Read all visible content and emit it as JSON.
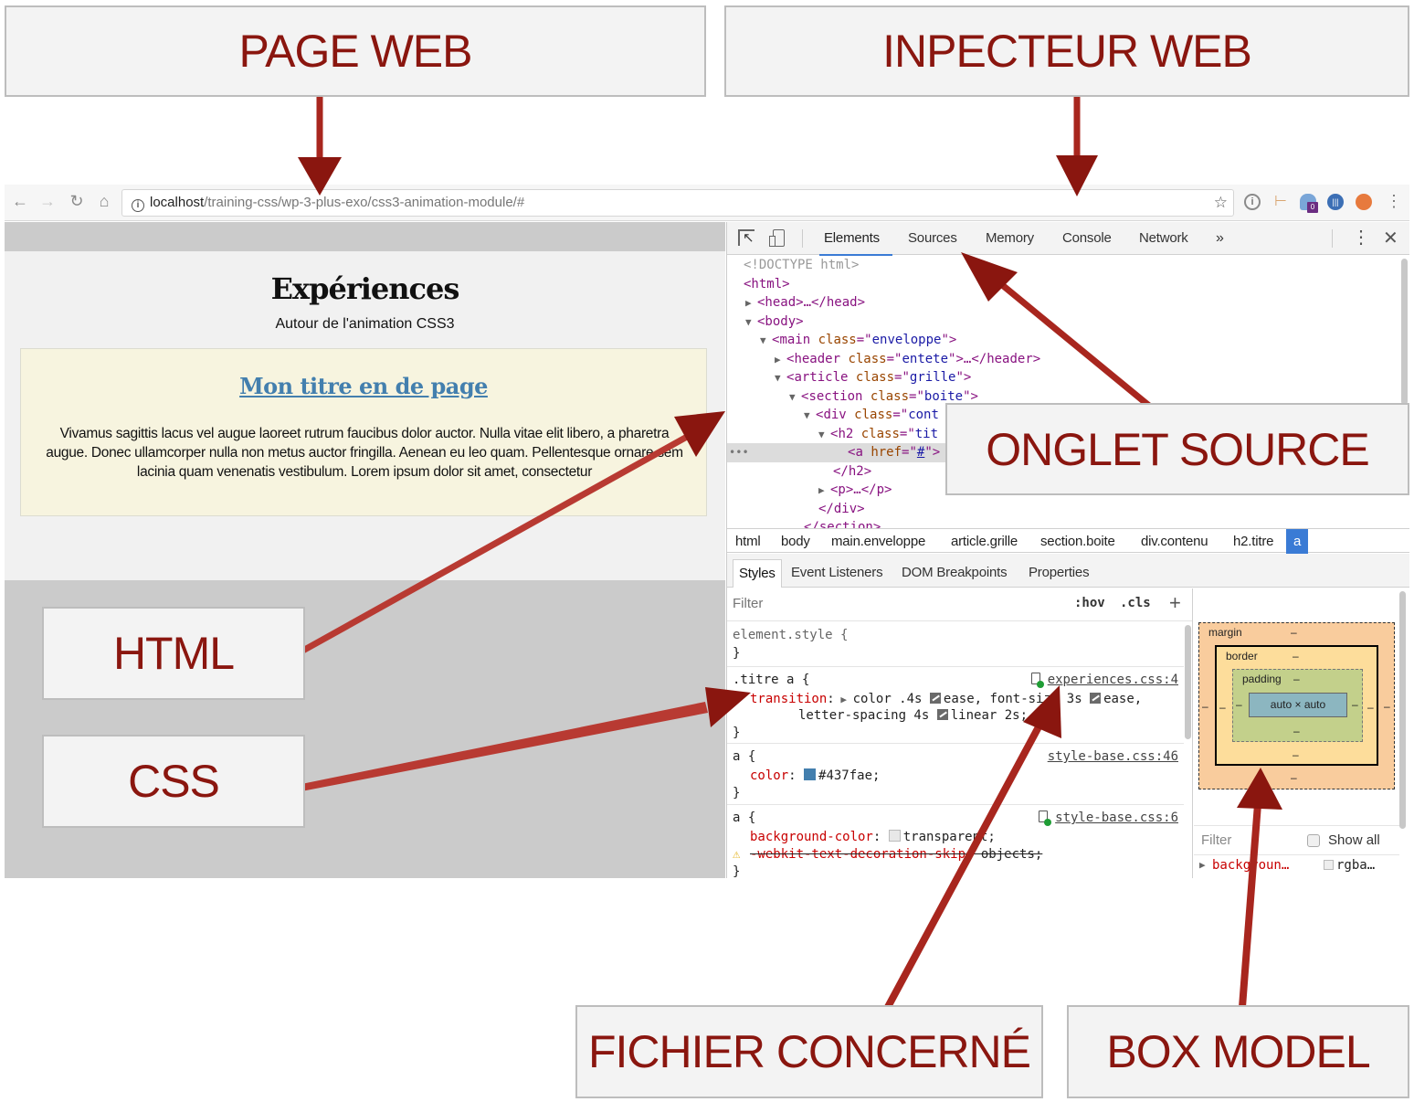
{
  "callouts": {
    "page_web": "PAGE WEB",
    "inspecteur_web": "INPECTEUR WEB",
    "onglet_source": "ONGLET SOURCE",
    "html": "HTML",
    "css": "CSS",
    "fichier_concerne": "FICHIER CONCERNÉ",
    "box_model": "BOX MODEL",
    "color": "#8a160f"
  },
  "browser": {
    "url_host": "localhost",
    "url_path": "/training-css/wp-3-plus-exo/css3-animation-module/#",
    "nav_back_icon": "←",
    "nav_forward_icon": "→",
    "reload_icon": "↻",
    "home_icon": "⌂",
    "bookmark_icon": "☆",
    "extensions": [
      "1password-icon",
      "sign-icon",
      "ghostery-icon",
      "badge-extension-icon",
      "duckduckgo-icon"
    ],
    "ghostery_badge": "0",
    "menu_icon": "⋮"
  },
  "page": {
    "title": "Expériences",
    "subtitle": "Autour de l'animation CSS3",
    "card_title": "Mon titre en de page",
    "card_text": "Vivamus sagittis lacus vel augue laoreet rutrum faucibus dolor auctor. Nulla vitae elit libero, a pharetra augue. Donec ullamcorper nulla non metus auctor fringilla. Aenean eu leo quam. Pellentesque ornare sem lacinia quam venenatis vestibulum. Lorem ipsum dolor sit amet, consectetur",
    "link_color": "#437fae"
  },
  "devtools": {
    "tabs": [
      "Elements",
      "Sources",
      "Memory",
      "Console",
      "Network",
      "»"
    ],
    "active_tab": "Elements",
    "dom": [
      {
        "text": "<!DOCTYPE html>"
      },
      {
        "text": "<html>"
      },
      {
        "text": "<head>…</head>",
        "toggle": "▶"
      },
      {
        "text": "<body>",
        "toggle": "▼"
      },
      {
        "tag": "main",
        "attr": "class",
        "val": "enveloppe",
        "toggle": "▼"
      },
      {
        "tag": "header",
        "attr": "class",
        "val": "entete",
        "suffix": "…</header>",
        "toggle": "▶"
      },
      {
        "tag": "article",
        "attr": "class",
        "val": "grille",
        "toggle": "▼"
      },
      {
        "tag": "section",
        "attr": "class",
        "val": "boite",
        "toggle": "▼"
      },
      {
        "tag": "div",
        "attr": "class",
        "val": "cont",
        "toggle": "▼"
      },
      {
        "tag": "h2",
        "attr": "class",
        "val": "tit",
        "toggle": "▼"
      },
      {
        "tag": "a",
        "attr": "href",
        "val": "#",
        "selected": true
      },
      {
        "text": "</h2>"
      },
      {
        "text": "<p>…</p>",
        "toggle": "▶"
      },
      {
        "text": "</div>"
      },
      {
        "text": "</section>"
      }
    ],
    "breadcrumbs": [
      "html",
      "body",
      "main.enveloppe",
      "article.grille",
      "section.boite",
      "div.contenu",
      "h2.titre",
      "a"
    ],
    "sub_tabs": [
      "Styles",
      "Event Listeners",
      "DOM Breakpoints",
      "Properties"
    ],
    "styles": {
      "filter_placeholder": "Filter",
      "hov": ":hov",
      "cls": ".cls",
      "add": "+",
      "rules": [
        {
          "selector": "element.style {",
          "close": "}"
        },
        {
          "selector": ".titre a {",
          "source": "experiences.css:4",
          "prop": "transition",
          "value_line1": "color .4s",
          "ease1": "ease, font-size 3s",
          "ease2": "ease,",
          "value_line2": "letter-spacing 4s",
          "ease3": "linear 2s;",
          "close": "}"
        },
        {
          "selector": "a {",
          "source": "style-base.css:46",
          "prop": "color",
          "value": "#437fae;",
          "swatch": "#437fae",
          "close": "}"
        },
        {
          "selector": "a {",
          "source": "style-base.css:6",
          "prop": "background-color",
          "value": "transparent;",
          "prop2": "-webkit-text-decoration-skip",
          "value2": "objects;",
          "close": "}"
        }
      ]
    },
    "box_model": {
      "margin_label": "margin",
      "border_label": "border",
      "padding_label": "padding",
      "content": "auto × auto",
      "dash": "–"
    },
    "computed": {
      "filter_placeholder": "Filter",
      "show_all": "Show all",
      "row_name": "backgroun…",
      "row_value": "rgba…"
    }
  }
}
